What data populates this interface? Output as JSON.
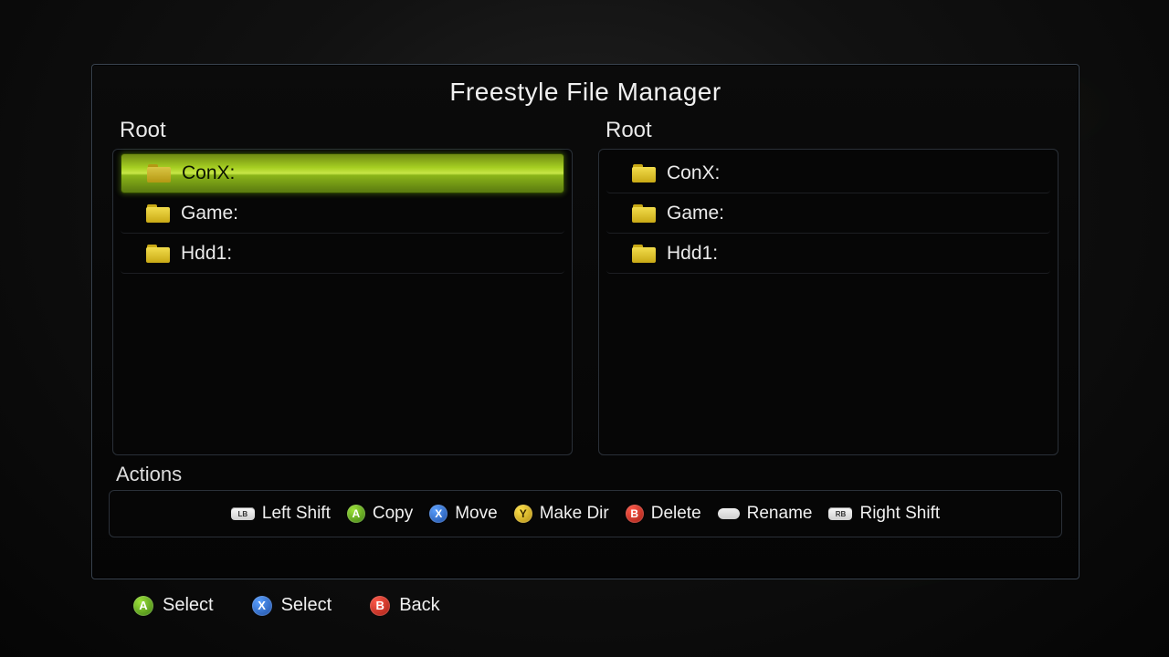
{
  "title": "Freestyle File Manager",
  "left_panel": {
    "label": "Root",
    "items": [
      {
        "name": "ConX:",
        "selected": true,
        "icon": "folder"
      },
      {
        "name": "Game:",
        "selected": false,
        "icon": "folder"
      },
      {
        "name": "Hdd1:",
        "selected": false,
        "icon": "folder"
      }
    ]
  },
  "right_panel": {
    "label": "Root",
    "items": [
      {
        "name": "ConX:",
        "selected": false,
        "icon": "folder"
      },
      {
        "name": "Game:",
        "selected": false,
        "icon": "folder"
      },
      {
        "name": "Hdd1:",
        "selected": false,
        "icon": "folder"
      }
    ]
  },
  "actions": {
    "label": "Actions",
    "items": [
      {
        "key_kind": "bumper",
        "key_label": "LB",
        "label": "Left Shift"
      },
      {
        "key_kind": "face",
        "key_class": "btn-A",
        "key_glyph": "A",
        "label": "Copy"
      },
      {
        "key_kind": "face",
        "key_class": "btn-X",
        "key_glyph": "X",
        "label": "Move"
      },
      {
        "key_kind": "face",
        "key_class": "btn-Y",
        "key_glyph": "Y",
        "label": "Make Dir"
      },
      {
        "key_kind": "face",
        "key_class": "btn-B",
        "key_glyph": "B",
        "label": "Delete"
      },
      {
        "key_kind": "oval",
        "label": "Rename"
      },
      {
        "key_kind": "bumper",
        "key_label": "RB",
        "label": "Right Shift"
      }
    ]
  },
  "bottom_hints": [
    {
      "key_class": "btn-A",
      "key_glyph": "A",
      "label": "Select"
    },
    {
      "key_class": "btn-X",
      "key_glyph": "X",
      "label": "Select"
    },
    {
      "key_class": "btn-B",
      "key_glyph": "B",
      "label": "Back"
    }
  ]
}
